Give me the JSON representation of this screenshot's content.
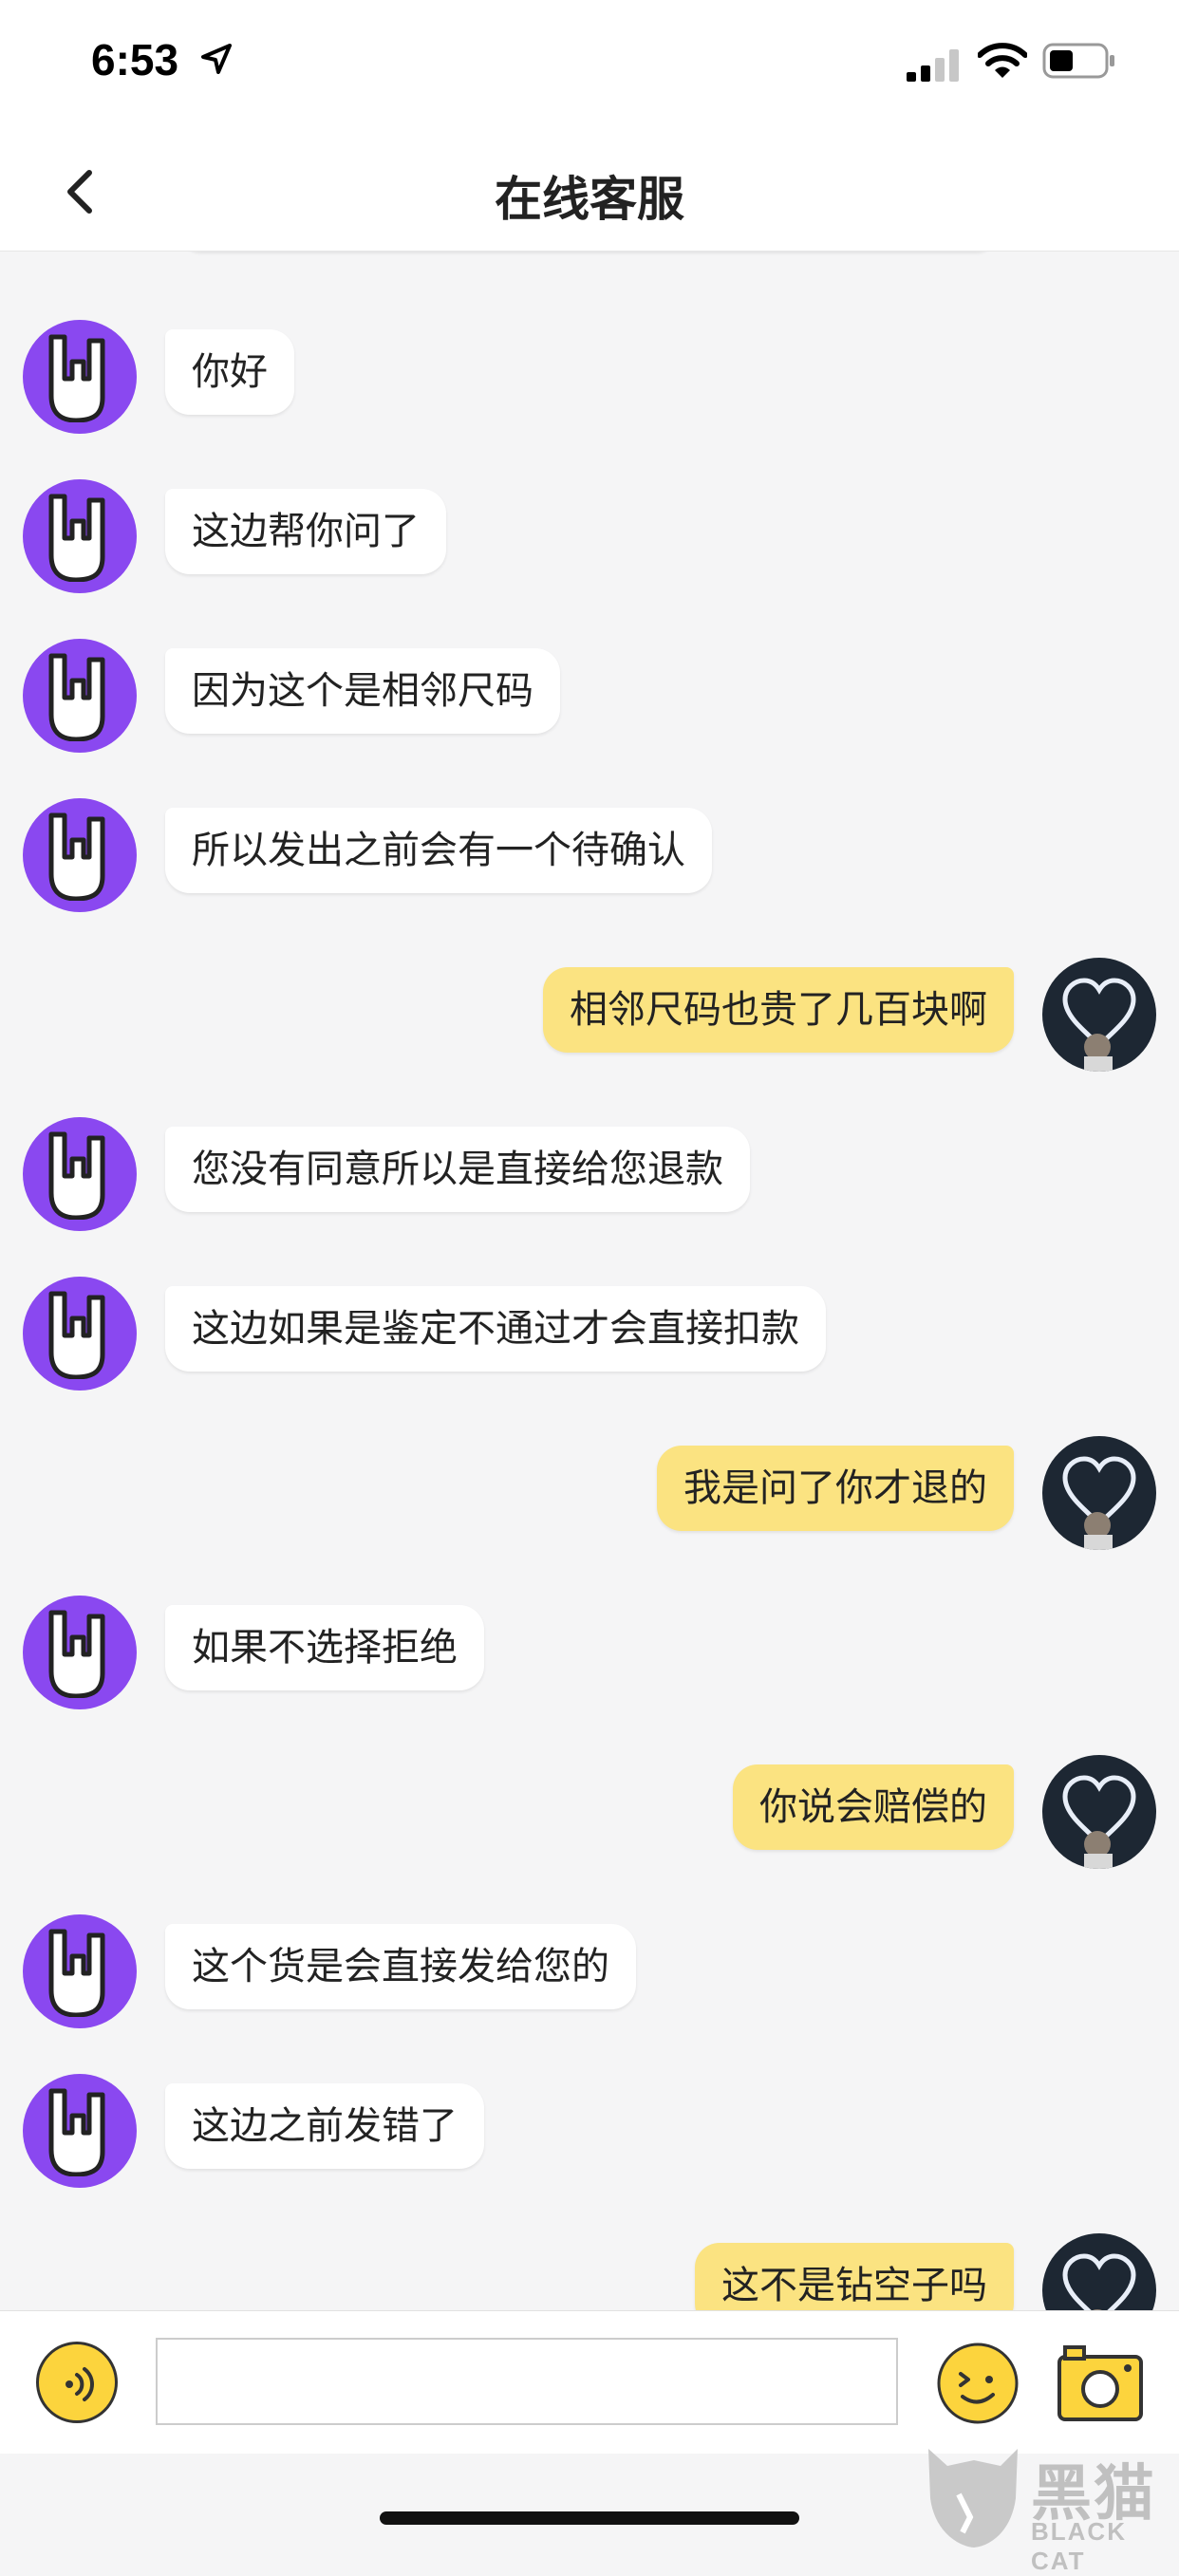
{
  "status_bar": {
    "time": "6:53"
  },
  "nav": {
    "title": "在线客服"
  },
  "messages": [
    {
      "from": "agent",
      "text": "你好"
    },
    {
      "from": "agent",
      "text": "这边帮你问了"
    },
    {
      "from": "agent",
      "text": "因为这个是相邻尺码"
    },
    {
      "from": "agent",
      "text": "所以发出之前会有一个待确认"
    },
    {
      "from": "user",
      "text": "相邻尺码也贵了几百块啊"
    },
    {
      "from": "agent",
      "text": "您没有同意所以是直接给您退款"
    },
    {
      "from": "agent",
      "text": "这边如果是鉴定不通过才会直接扣款"
    },
    {
      "from": "user",
      "text": "我是问了你才退的"
    },
    {
      "from": "agent",
      "text": "如果不选择拒绝"
    },
    {
      "from": "user",
      "text": "你说会赔偿的"
    },
    {
      "from": "agent",
      "text": "这个货是会直接发给您的"
    },
    {
      "from": "agent",
      "text": "这边之前发错了"
    },
    {
      "from": "user",
      "text": "这不是钻空子吗"
    }
  ],
  "input": {
    "value": "",
    "placeholder": ""
  },
  "watermark": {
    "text": "黑猫",
    "sub": "BLACK CAT"
  },
  "colors": {
    "agent_avatar": "#8a48f0",
    "user_bubble": "#fbe381",
    "agent_bubble": "#ffffff",
    "accent": "#fcd43d"
  }
}
